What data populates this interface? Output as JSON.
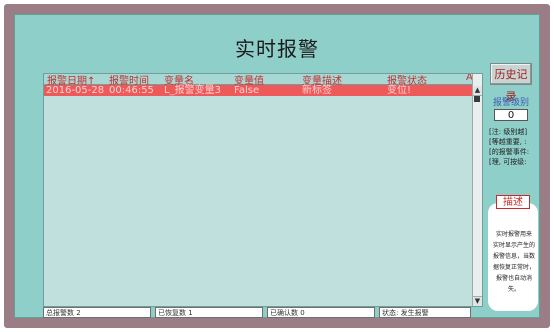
{
  "window": {
    "title": "实时报警"
  },
  "table": {
    "columns": [
      "报警日期↑",
      "报警时间",
      "变量名",
      "变量值",
      "变量描述",
      "报警状态",
      "A"
    ],
    "rows": [
      [
        "2016-05-28",
        "00:46:55",
        "L_报警变量3",
        "False",
        "新标签",
        "变位!"
      ]
    ]
  },
  "sidebar": {
    "history_button": "历史记录",
    "level_label": "报警级别",
    "level_value": "0",
    "note_lines": [
      "[注: 级别越]",
      "[等越重要, :",
      "[的报警事件:",
      "[理, 可按级:"
    ],
    "description_title": "描述",
    "description_lines": [
      "实时报警用来",
      "实时显示产生的",
      "报警信息，当数",
      "据恢复正常时，",
      "报警也自动消失。"
    ]
  },
  "status": {
    "total": "总报警数 2",
    "restored": "已恢复数 1",
    "confirmed": "已确认数 0",
    "state": "状态: 发生报警"
  },
  "colors": {
    "frame": "#9b7d86",
    "panel": "#8fcfc9",
    "row_highlight": "#ee5a5a",
    "header_text": "#c43030",
    "level_label": "#3b5bb0"
  }
}
